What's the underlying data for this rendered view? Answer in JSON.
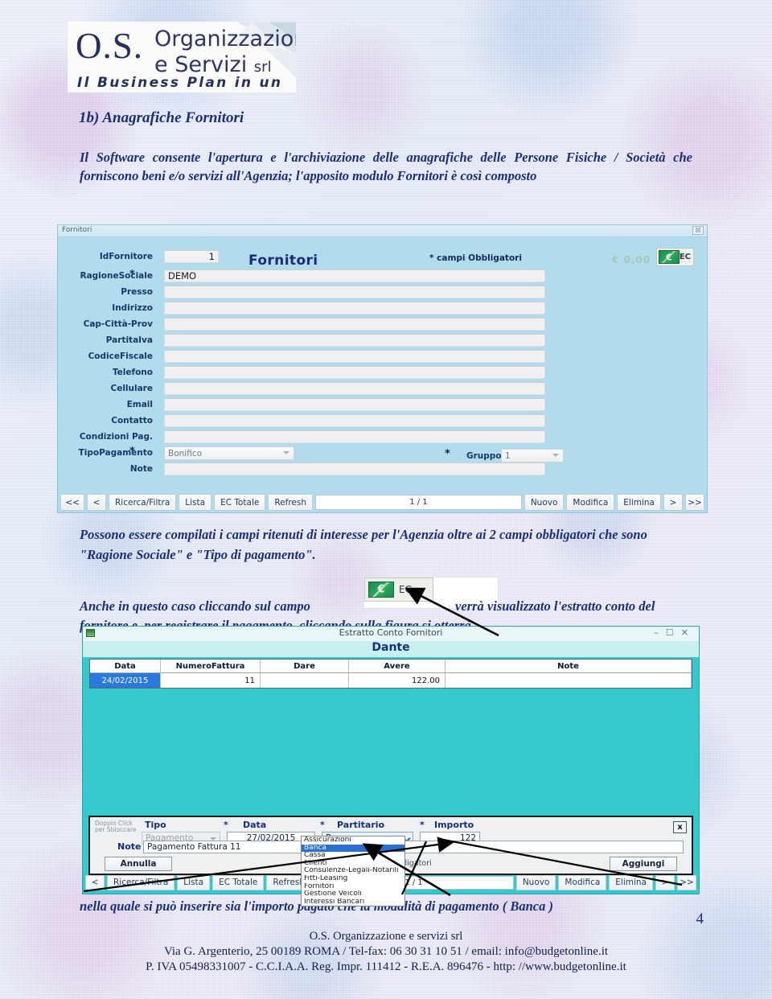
{
  "logo": {
    "initials": "O.S.",
    "line1": "Organizzazione",
    "line2": "e Servizi",
    "line2_small": "srl",
    "tagline": "Il Business Plan in un click"
  },
  "page": {
    "heading": "1b) Anagrafiche Fornitori",
    "intro": "Il Software consente l'apertura e l'archiviazione delle anagrafiche delle Persone Fisiche / Società che forniscono beni e/o servizi all'Agenzia; l'apposito modulo Fornitori è così composto",
    "mid_text": "Possono essere compilati i campi ritenuti di interesse per l'Agenzia oltre ai 2 campi obbligatori che sono \"Ragione Sociale\"  e  \"Tipo di pagamento\".",
    "ec_text_1": "Anche in questo caso cliccando sul campo",
    "ec_text_2": "verrà visualizzato l'estratto conto del fornitore e, per registrare il pagamento, cliccando sulla figura si otterrà",
    "bottom_text": "nella quale si può inserire sia l'importo pagato che la modalità di pagamento ( Banca )",
    "page_number": "4"
  },
  "footer": {
    "line1": "O.S. Organizzazione e servizi srl",
    "line2": "Via G. Argenterio, 25  00189  ROMA / Tel-fax: 06 30 31 10 51 / email: info@budgetonline.it",
    "line3": "P. IVA 05498331007 - C.C.I.A.A. Reg. Impr. 111412 - R.E.A. 896476 - http: //www.budgetonline.it"
  },
  "window_fornitori": {
    "titlebar": "Fornitori",
    "close_glyph": "☒",
    "form_title": "Fornitori",
    "required_note": "* campi Obbligatori",
    "balance": "€ 0,00",
    "ec_button_label": "EC",
    "fields": [
      {
        "label": "IdFornitore",
        "value": "1",
        "required": false,
        "type": "id"
      },
      {
        "label": "RagioneSociale",
        "value": "DEMO",
        "required": true,
        "type": "text"
      },
      {
        "label": "Presso",
        "value": "",
        "required": false,
        "type": "text"
      },
      {
        "label": "Indirizzo",
        "value": "",
        "required": false,
        "type": "text"
      },
      {
        "label": "Cap-Città-Prov",
        "value": "",
        "required": false,
        "type": "text"
      },
      {
        "label": "PartitaIva",
        "value": "",
        "required": false,
        "type": "text"
      },
      {
        "label": "CodiceFiscale",
        "value": "",
        "required": false,
        "type": "text"
      },
      {
        "label": "Telefono",
        "value": "",
        "required": false,
        "type": "text"
      },
      {
        "label": "Cellulare",
        "value": "",
        "required": false,
        "type": "text"
      },
      {
        "label": "Email",
        "value": "",
        "required": false,
        "type": "text"
      },
      {
        "label": "Contatto",
        "value": "",
        "required": false,
        "type": "text"
      },
      {
        "label": "Condizioni Pag.",
        "value": "",
        "required": false,
        "type": "text"
      },
      {
        "label": "TipoPagamento",
        "value": "Bonifico",
        "required": true,
        "type": "select"
      },
      {
        "label": "Note",
        "value": "",
        "required": false,
        "type": "text"
      }
    ],
    "gruppo": {
      "label": "Gruppo",
      "value": "1",
      "required": true
    },
    "toolbar": {
      "first": "<<",
      "prev": "<",
      "search": "Ricerca/Filtra",
      "list": "Lista",
      "ec_total": "EC Totale",
      "refresh": "Refresh",
      "counter": "1 / 1",
      "new": "Nuovo",
      "edit": "Modifica",
      "delete": "Elimina",
      "next": ">",
      "last": ">>"
    }
  },
  "window_estratto": {
    "titlebar": "Estratto Conto Fornitori",
    "minimize": "–",
    "maximize": "☐",
    "close": "✕",
    "supplier_name": "Dante",
    "columns": [
      "Data",
      "NumeroFattura",
      "Dare",
      "Avere",
      "Note"
    ],
    "rows": [
      {
        "data": "24/02/2015",
        "numero": "11",
        "dare": "",
        "avere": "122.00",
        "note": ""
      }
    ],
    "toolbar": {
      "prev": "<",
      "search": "Ricerca/Filtra",
      "list": "Lista",
      "ec_total": "EC Totale",
      "refresh": "Refresh",
      "counter": "1 / 1",
      "new": "Nuovo",
      "edit": "Modifica",
      "delete": "Elimina",
      "next": ">",
      "last": ">>"
    }
  },
  "payment_dialog": {
    "double_click_hint": "Doppio Click\nper Sbloccare",
    "labels": {
      "tipo": "Tipo",
      "data": "Data",
      "partitario": "Partitario",
      "importo": "Importo",
      "note": "Note"
    },
    "tipo_value": "Pagamento",
    "data_value": "27/02/2015",
    "partitario_value": "Banca",
    "importo_value": "122",
    "note_value": "Pagamento Fattura 11",
    "cancel_label": "Annulla",
    "add_label": "Aggiungi",
    "required_note": "(*) Campi Obbligatori",
    "close_label": "x",
    "partitario_options": [
      "Assicurazioni",
      "Banca",
      "Cassa",
      "Clienti",
      "Consulenze-Legali-Notarili",
      "Fitti-Leasing",
      "Fornitori",
      "Gestione Veicoli",
      "Interessi Bancari"
    ],
    "selected_option_index": 1
  },
  "colors": {
    "heading": "#1b2f78",
    "form_bg": "#b0dcee",
    "window2_bg": "#35c8cd",
    "select_highlight": "#2a6fd4",
    "row_highlight": "#2a7ade"
  }
}
